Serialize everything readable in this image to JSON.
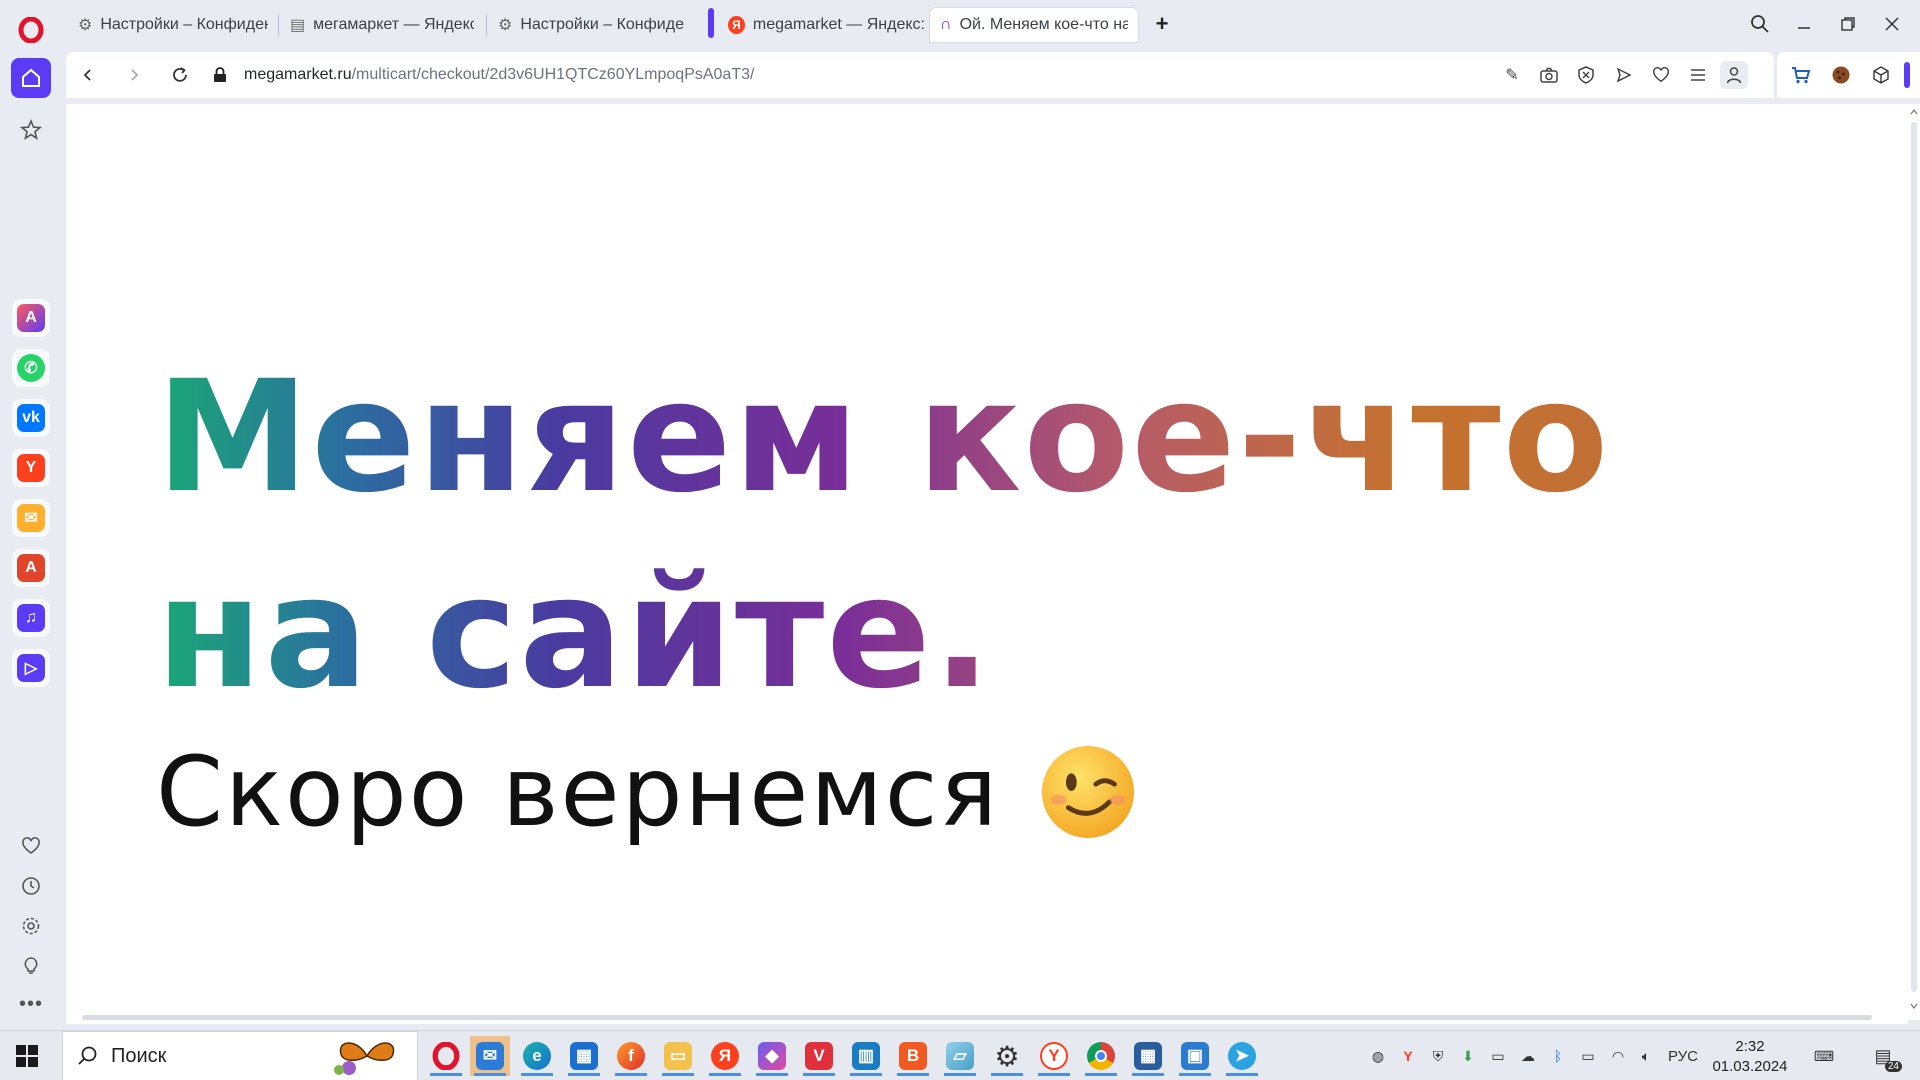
{
  "tabs": [
    {
      "label": "Настройки – Конфиденциальность",
      "icon": "gear-icon"
    },
    {
      "label": "мегамаркет — Яндекс: нашлось",
      "icon": "document-icon"
    },
    {
      "label": "Настройки – Конфиденциальность",
      "icon": "gear-icon"
    },
    {
      "label": "megamarket — Яндекс: нашлось",
      "icon": "yandex-icon"
    },
    {
      "label": "Ой. Меняем кое-что на сайте",
      "icon": "megamarket-icon",
      "active": true
    }
  ],
  "address": {
    "host": "megamarket.ru",
    "path": "/multicart/checkout/2d3v6UH1QTCz60YLmpoqPsA0aT3/"
  },
  "page": {
    "headline_line1": "Меняем кое-что",
    "headline_line2": "на сайте.",
    "subline": "Скоро вернемся",
    "emoji": "winking-face"
  },
  "taskbar": {
    "search_label": "Поиск",
    "language": "РУС",
    "time": "2:32",
    "date": "01.03.2024",
    "notifications": "24"
  },
  "colors": {
    "accent": "#5b3cf5",
    "headline_gradient": [
      "#1aa875",
      "#2b6fa0",
      "#4a3aa0",
      "#7a2e98",
      "#b65b6a",
      "#c5722e"
    ]
  }
}
